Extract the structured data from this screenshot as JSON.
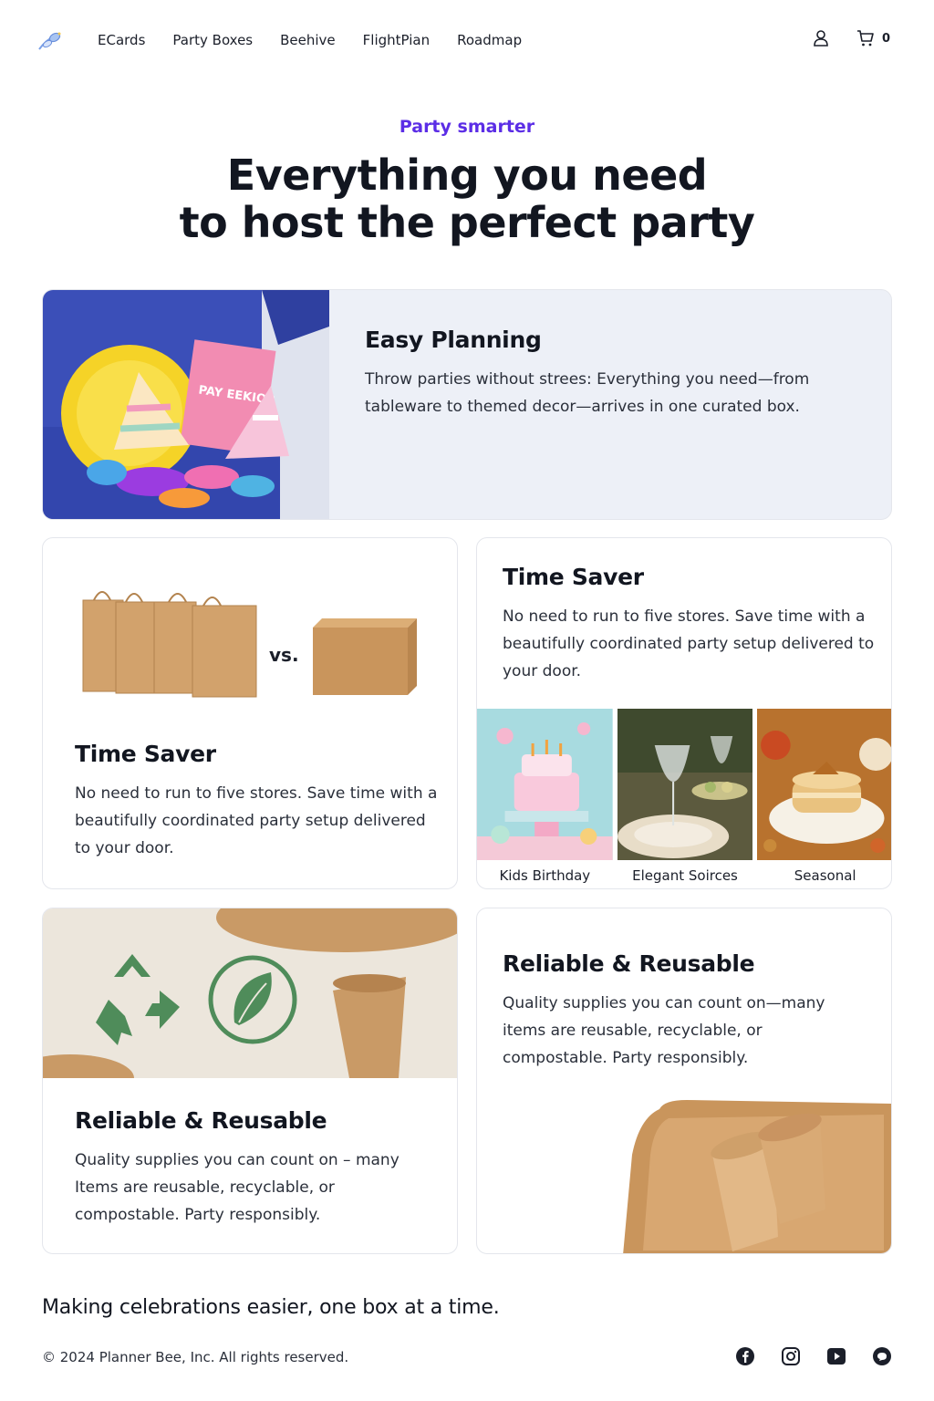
{
  "nav": {
    "links": [
      "ECards",
      "Party Boxes",
      "Beehive",
      "FlightPian",
      "Roadmap"
    ],
    "cart_count": "0"
  },
  "hero": {
    "eyebrow": "Party smarter",
    "title_line1": "Everything you need",
    "title_line2": "to host the perfect party"
  },
  "cards": {
    "easy_planning": {
      "title": "Easy Planning",
      "body": "Throw parties without strees: Everything you need—from tableware to themed decor—arrives in one curated box.",
      "card_text": "PAY EEKIOB"
    },
    "time_saver_left": {
      "title": "Time Saver",
      "body": "No need to run to five stores. Save time with a beautifully coordinated party setup delivered to your door.",
      "vs": "vs."
    },
    "time_saver_right": {
      "title": "Time Saver",
      "body": "No need to run to five stores. Save time with a beautifully coordinated party setup delivered to your door.",
      "thumbnails": [
        "Kids Birthday",
        "Elegant Soirces",
        "Seasonal"
      ]
    },
    "reliable_left": {
      "title": "Reliable & Reusable",
      "body": "Quality supplies you can count on – many Items are reusable, recyclable, or compostable. Party responsibly."
    },
    "reliable_right": {
      "title": "Reliable & Reusable",
      "body": "Quality supplies you can count on—many items are reusable, recyclable, or compostable. Party responsibly."
    }
  },
  "footer": {
    "tagline": "Making celebrations easier, one box at a time.",
    "copyright": "© 2024 Planner Bee, Inc. All rights reserved.",
    "socials": [
      "facebook-icon",
      "instagram-icon",
      "youtube-icon",
      "chat-icon"
    ]
  },
  "colors": {
    "accent": "#5b2de6",
    "card_bg": "#edf0f7",
    "kraft": "#c99a66"
  }
}
